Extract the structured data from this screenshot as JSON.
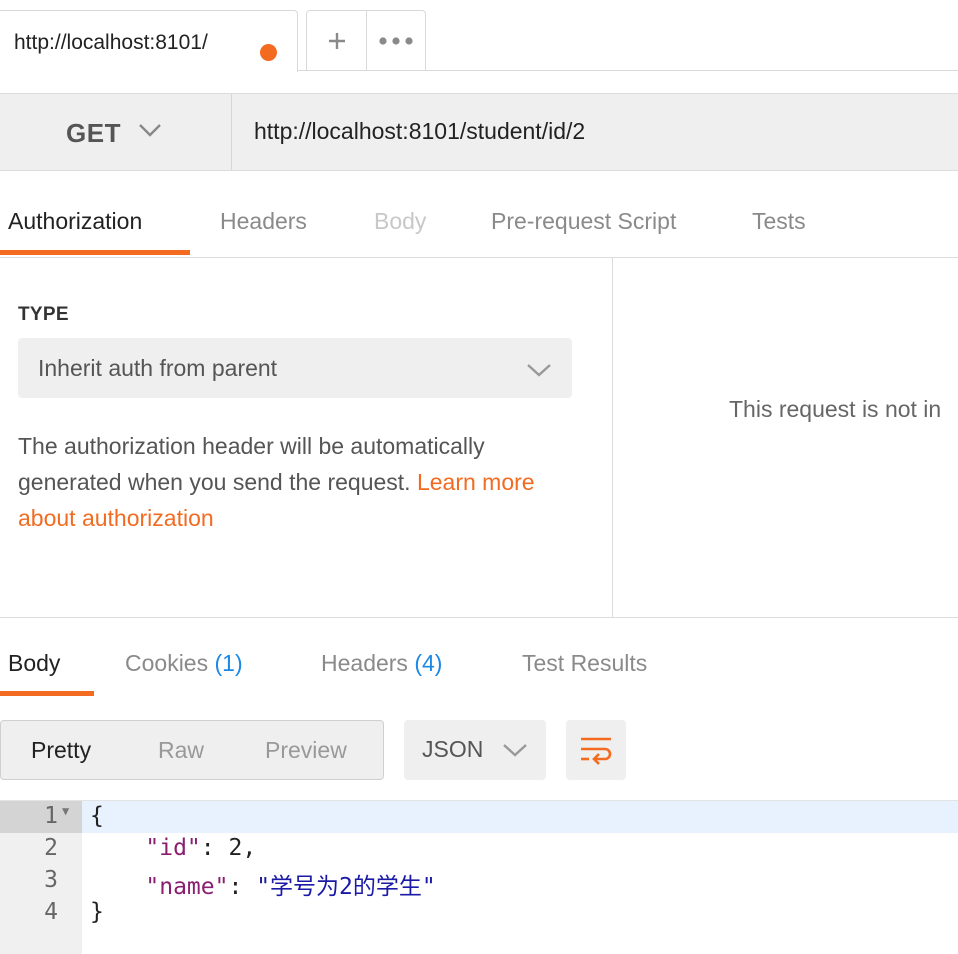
{
  "tabs": {
    "active_tab_label": "http://localhost:8101/",
    "add_icon": "plus-icon",
    "more_icon": "more-icon"
  },
  "request": {
    "method": "GET",
    "url": "http://localhost:8101/student/id/2"
  },
  "request_tabs": [
    "Authorization",
    "Headers",
    "Body",
    "Pre-request Script",
    "Tests"
  ],
  "auth": {
    "type_label": "TYPE",
    "type_value": "Inherit auth from parent",
    "description": "The authorization header will be automatically generated when you send the request.",
    "learn_more": "Learn more about authorization",
    "side_message": "This request is not in"
  },
  "response_tabs": {
    "body": "Body",
    "cookies": "Cookies",
    "cookies_count": "(1)",
    "headers": "Headers",
    "headers_count": "(4)",
    "test_results": "Test Results"
  },
  "view_modes": [
    "Pretty",
    "Raw",
    "Preview"
  ],
  "format": "JSON",
  "code_lines": [
    {
      "n": "1",
      "open": "{"
    },
    {
      "n": "2",
      "key": "\"id\"",
      "sep": ": ",
      "value": "2",
      "tail": ","
    },
    {
      "n": "3",
      "key": "\"name\"",
      "sep": ": ",
      "value": "\"学号为2的学生\""
    },
    {
      "n": "4",
      "close": "}"
    }
  ],
  "colors": {
    "accent": "#f26b21",
    "count_blue": "#1e88e5",
    "json_key": "#8a1f6f",
    "json_string": "#1a1aa6"
  }
}
